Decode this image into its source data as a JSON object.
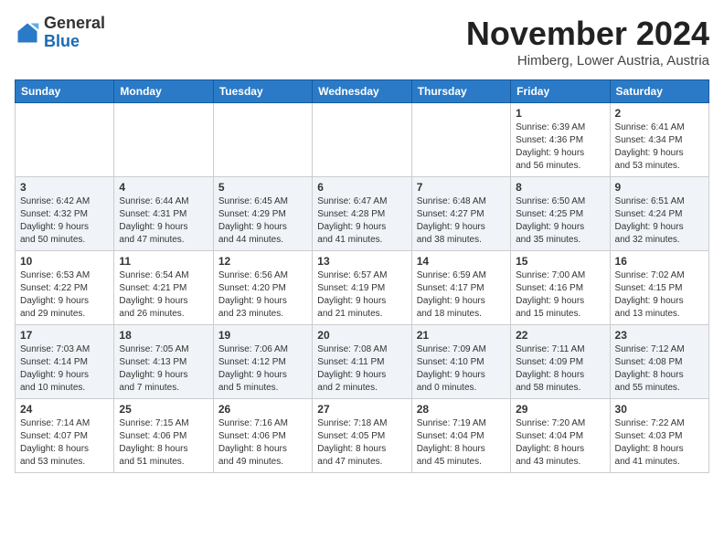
{
  "header": {
    "logo_line1": "General",
    "logo_line2": "Blue",
    "month": "November 2024",
    "location": "Himberg, Lower Austria, Austria"
  },
  "weekdays": [
    "Sunday",
    "Monday",
    "Tuesday",
    "Wednesday",
    "Thursday",
    "Friday",
    "Saturday"
  ],
  "weeks": [
    [
      {
        "day": "",
        "info": ""
      },
      {
        "day": "",
        "info": ""
      },
      {
        "day": "",
        "info": ""
      },
      {
        "day": "",
        "info": ""
      },
      {
        "day": "",
        "info": ""
      },
      {
        "day": "1",
        "info": "Sunrise: 6:39 AM\nSunset: 4:36 PM\nDaylight: 9 hours\nand 56 minutes."
      },
      {
        "day": "2",
        "info": "Sunrise: 6:41 AM\nSunset: 4:34 PM\nDaylight: 9 hours\nand 53 minutes."
      }
    ],
    [
      {
        "day": "3",
        "info": "Sunrise: 6:42 AM\nSunset: 4:32 PM\nDaylight: 9 hours\nand 50 minutes."
      },
      {
        "day": "4",
        "info": "Sunrise: 6:44 AM\nSunset: 4:31 PM\nDaylight: 9 hours\nand 47 minutes."
      },
      {
        "day": "5",
        "info": "Sunrise: 6:45 AM\nSunset: 4:29 PM\nDaylight: 9 hours\nand 44 minutes."
      },
      {
        "day": "6",
        "info": "Sunrise: 6:47 AM\nSunset: 4:28 PM\nDaylight: 9 hours\nand 41 minutes."
      },
      {
        "day": "7",
        "info": "Sunrise: 6:48 AM\nSunset: 4:27 PM\nDaylight: 9 hours\nand 38 minutes."
      },
      {
        "day": "8",
        "info": "Sunrise: 6:50 AM\nSunset: 4:25 PM\nDaylight: 9 hours\nand 35 minutes."
      },
      {
        "day": "9",
        "info": "Sunrise: 6:51 AM\nSunset: 4:24 PM\nDaylight: 9 hours\nand 32 minutes."
      }
    ],
    [
      {
        "day": "10",
        "info": "Sunrise: 6:53 AM\nSunset: 4:22 PM\nDaylight: 9 hours\nand 29 minutes."
      },
      {
        "day": "11",
        "info": "Sunrise: 6:54 AM\nSunset: 4:21 PM\nDaylight: 9 hours\nand 26 minutes."
      },
      {
        "day": "12",
        "info": "Sunrise: 6:56 AM\nSunset: 4:20 PM\nDaylight: 9 hours\nand 23 minutes."
      },
      {
        "day": "13",
        "info": "Sunrise: 6:57 AM\nSunset: 4:19 PM\nDaylight: 9 hours\nand 21 minutes."
      },
      {
        "day": "14",
        "info": "Sunrise: 6:59 AM\nSunset: 4:17 PM\nDaylight: 9 hours\nand 18 minutes."
      },
      {
        "day": "15",
        "info": "Sunrise: 7:00 AM\nSunset: 4:16 PM\nDaylight: 9 hours\nand 15 minutes."
      },
      {
        "day": "16",
        "info": "Sunrise: 7:02 AM\nSunset: 4:15 PM\nDaylight: 9 hours\nand 13 minutes."
      }
    ],
    [
      {
        "day": "17",
        "info": "Sunrise: 7:03 AM\nSunset: 4:14 PM\nDaylight: 9 hours\nand 10 minutes."
      },
      {
        "day": "18",
        "info": "Sunrise: 7:05 AM\nSunset: 4:13 PM\nDaylight: 9 hours\nand 7 minutes."
      },
      {
        "day": "19",
        "info": "Sunrise: 7:06 AM\nSunset: 4:12 PM\nDaylight: 9 hours\nand 5 minutes."
      },
      {
        "day": "20",
        "info": "Sunrise: 7:08 AM\nSunset: 4:11 PM\nDaylight: 9 hours\nand 2 minutes."
      },
      {
        "day": "21",
        "info": "Sunrise: 7:09 AM\nSunset: 4:10 PM\nDaylight: 9 hours\nand 0 minutes."
      },
      {
        "day": "22",
        "info": "Sunrise: 7:11 AM\nSunset: 4:09 PM\nDaylight: 8 hours\nand 58 minutes."
      },
      {
        "day": "23",
        "info": "Sunrise: 7:12 AM\nSunset: 4:08 PM\nDaylight: 8 hours\nand 55 minutes."
      }
    ],
    [
      {
        "day": "24",
        "info": "Sunrise: 7:14 AM\nSunset: 4:07 PM\nDaylight: 8 hours\nand 53 minutes."
      },
      {
        "day": "25",
        "info": "Sunrise: 7:15 AM\nSunset: 4:06 PM\nDaylight: 8 hours\nand 51 minutes."
      },
      {
        "day": "26",
        "info": "Sunrise: 7:16 AM\nSunset: 4:06 PM\nDaylight: 8 hours\nand 49 minutes."
      },
      {
        "day": "27",
        "info": "Sunrise: 7:18 AM\nSunset: 4:05 PM\nDaylight: 8 hours\nand 47 minutes."
      },
      {
        "day": "28",
        "info": "Sunrise: 7:19 AM\nSunset: 4:04 PM\nDaylight: 8 hours\nand 45 minutes."
      },
      {
        "day": "29",
        "info": "Sunrise: 7:20 AM\nSunset: 4:04 PM\nDaylight: 8 hours\nand 43 minutes."
      },
      {
        "day": "30",
        "info": "Sunrise: 7:22 AM\nSunset: 4:03 PM\nDaylight: 8 hours\nand 41 minutes."
      }
    ]
  ]
}
